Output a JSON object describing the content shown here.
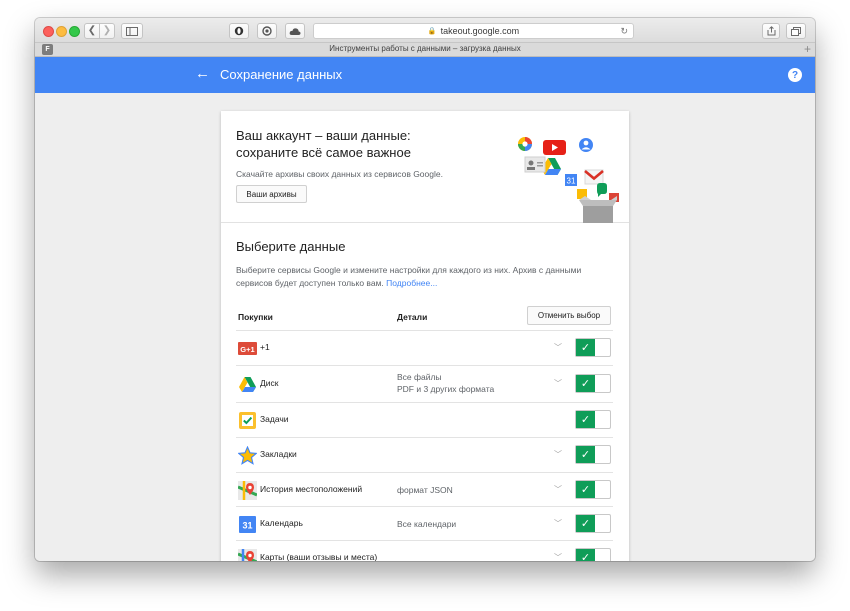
{
  "browser": {
    "url": "takeout.google.com",
    "tab_title": "Инструменты работы с данными – загрузка данных",
    "tab_favicon_letter": "F",
    "tab_add_glyph": "+"
  },
  "appbar": {
    "title": "Сохранение данных",
    "help_glyph": "?",
    "color": "#4285f4"
  },
  "hero": {
    "title_line1": "Ваш аккаунт – ваши данные:",
    "title_line2": "сохраните всё самое важное",
    "subtitle": "Скачайте архивы своих данных из сервисов Google.",
    "archives_button": "Ваши архивы",
    "calendar_icon_text": "31"
  },
  "select": {
    "title": "Выберите данные",
    "description": "Выберите сервисы Google и измените настройки для каждого из них. Архив с данными сервисов будет доступен только вам.",
    "more_link": "Подробнее..."
  },
  "table": {
    "header_product": "Покупки",
    "header_details": "Детали",
    "deselect_button": "Отменить выбор"
  },
  "services": [
    {
      "name": "+1",
      "icon": "google-plus-icon",
      "detail1": "",
      "detail2": "",
      "has_chevron": true,
      "checked": true
    },
    {
      "name": "Диск",
      "icon": "drive-icon",
      "detail1": "Все файлы",
      "detail2": "PDF и 3 других формата",
      "has_chevron": true,
      "checked": true
    },
    {
      "name": "Задачи",
      "icon": "tasks-icon",
      "detail1": "",
      "detail2": "",
      "has_chevron": false,
      "checked": true
    },
    {
      "name": "Закладки",
      "icon": "bookmarks-star-icon",
      "detail1": "",
      "detail2": "",
      "has_chevron": true,
      "checked": true
    },
    {
      "name": "История местоположений",
      "icon": "location-history-icon",
      "detail1": "формат JSON",
      "detail2": "",
      "has_chevron": true,
      "checked": true
    },
    {
      "name": "Календарь",
      "icon": "calendar-icon",
      "detail1": "Все календари",
      "detail2": "",
      "has_chevron": true,
      "checked": true
    },
    {
      "name": "Карты (ваши отзывы и места)",
      "icon": "maps-icon",
      "detail1": "",
      "detail2": "",
      "has_chevron": true,
      "checked": true
    }
  ],
  "glyphs": {
    "gplus_label": "G+1",
    "calendar_label": "31",
    "check": "✓",
    "chevron": "﹀"
  },
  "colors": {
    "toggle_on": "#0f9d58",
    "link": "#4285f4"
  }
}
